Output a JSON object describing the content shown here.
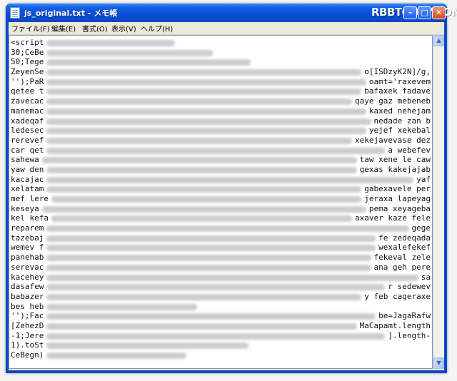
{
  "window": {
    "title": "js_original.txt - メモ帳",
    "watermark": "RBBTODAY.COM",
    "controls": {
      "minimize": "–",
      "maximize": "□",
      "close": "✕"
    },
    "app_icon": "notepad-icon"
  },
  "menu": [
    {
      "label": "ファイル(F)"
    },
    {
      "label": "編集(E)"
    },
    {
      "label": "書式(O)"
    },
    {
      "label": "表示(V)"
    },
    {
      "label": "ヘルプ(H)"
    }
  ],
  "editor": {
    "lines": [
      {
        "left": "<script",
        "right": ""
      },
      {
        "left": "30;CeBe",
        "right": ""
      },
      {
        "left": "50;Tege",
        "right": ""
      },
      {
        "left": "ZeyenSe",
        "right": "o[ISDzyK2N]/g,"
      },
      {
        "left": "'');PaR",
        "right": "oamt='raxevem"
      },
      {
        "left": "qetee t",
        "right": "bafaxek fadave"
      },
      {
        "left": "zavecac",
        "right": "qaye gaz mebeneb"
      },
      {
        "left": "manemac",
        "right": "kaxed nehejam"
      },
      {
        "left": "xadeqaf",
        "right": "nedade zan b"
      },
      {
        "left": "ledesec",
        "right": "yejef xekebal"
      },
      {
        "left": "rerevef",
        "right": "xekejavevase dez"
      },
      {
        "left": "car qet",
        "right": "a webefev"
      },
      {
        "left": "sahewa",
        "right": "taw xene le caw"
      },
      {
        "left": "yaw den",
        "right": "gexas kakejajab"
      },
      {
        "left": "kacajac",
        "right": "yaf"
      },
      {
        "left": "xelatam",
        "right": "gabexavele per"
      },
      {
        "left": "mef lere",
        "right": "jeraxa lapeyag"
      },
      {
        "left": "keseya",
        "right": "pema xeyageba"
      },
      {
        "left": "kel kefa",
        "right": "axaver kaze fele"
      },
      {
        "left": "reparem",
        "right": "gege"
      },
      {
        "left": "tazebaj",
        "right": "fe zedeqada"
      },
      {
        "left": "wemev f",
        "right": "wexalefekef"
      },
      {
        "left": "panehab",
        "right": "fekeval zele"
      },
      {
        "left": "serevac",
        "right": "ana geh pere"
      },
      {
        "left": "kacehey",
        "right": "sa"
      },
      {
        "left": "dasafew",
        "right": "r sedewev"
      },
      {
        "left": "babazer",
        "right": "y feb cageraxe"
      },
      {
        "left": "bes heb",
        "right": ""
      },
      {
        "left": "'');Fac",
        "right": "be=JagaRafw"
      },
      {
        "left": "[ZehezD",
        "right": "MaCapamt.length"
      },
      {
        "left": "-1;Jere",
        "right": "].length-"
      },
      {
        "left": "1).toSt",
        "right": ""
      },
      {
        "left": "CeBegn)",
        "right": ""
      }
    ]
  }
}
